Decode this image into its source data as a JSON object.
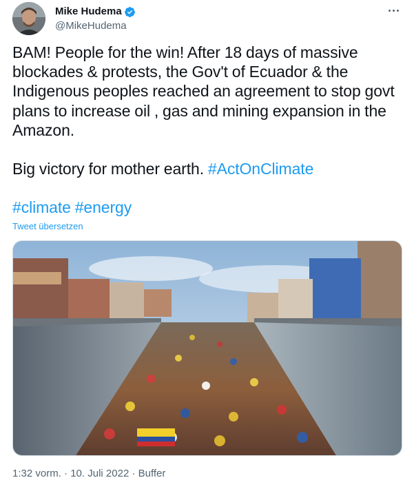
{
  "author": {
    "display_name": "Mike Hudema",
    "handle": "@MikeHudema",
    "verified": true,
    "avatar_icon": "person-avatar"
  },
  "tweet": {
    "paragraph1": "BAM! People for the win! After 18 days of massive blockades & protests, the Gov't of Ecuador & the Indigenous peoples reached an agreement to stop govt plans to increase oil , gas and mining expansion in the Amazon.",
    "paragraph2_text": "Big victory for mother earth. ",
    "paragraph2_hashtag": "#ActOnClimate",
    "hashtag_climate": "#climate",
    "hashtag_energy": "#energy",
    "translate_label": "Tweet übersetzen"
  },
  "media": {
    "type": "video-still",
    "description_icon": "crowd-protest-image"
  },
  "meta": {
    "time": "1:32 vorm.",
    "separator": " · ",
    "date": "10. Juli 2022",
    "source": "Buffer"
  },
  "colors": {
    "link": "#1d9bf0",
    "text": "#0f1419",
    "secondary": "#536471",
    "verified": "#1d9bf0"
  }
}
